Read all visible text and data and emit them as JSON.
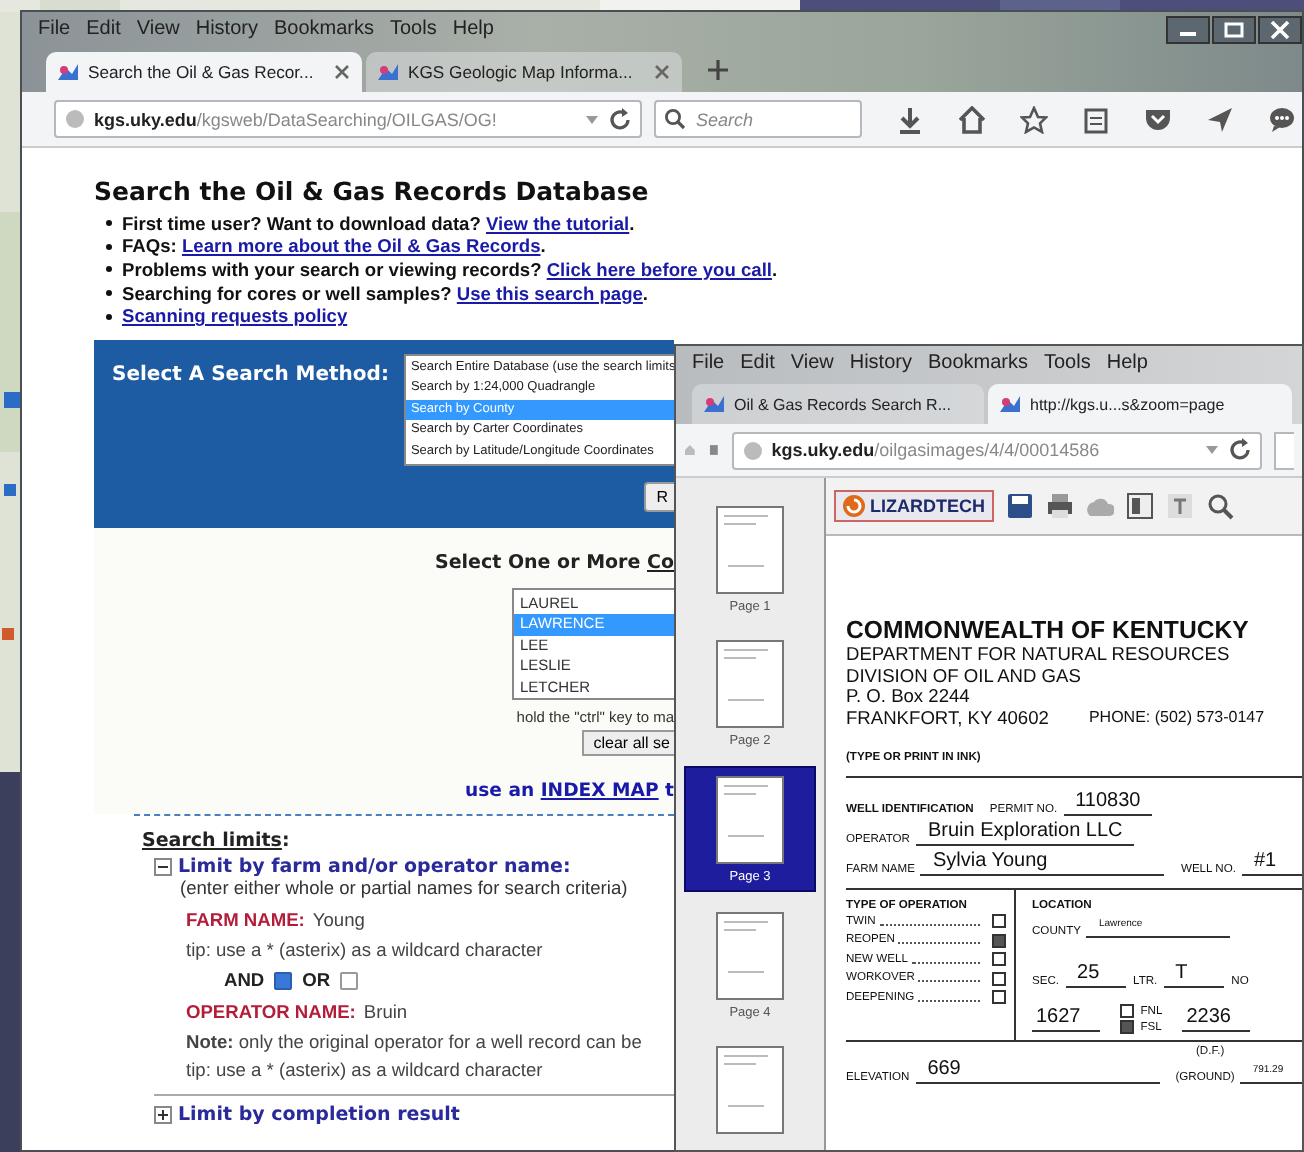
{
  "main_window": {
    "menu": [
      "File",
      "Edit",
      "View",
      "History",
      "Bookmarks",
      "Tools",
      "Help"
    ],
    "tabs": [
      {
        "label": "Search the Oil & Gas Recor...",
        "selected": true
      },
      {
        "label": "KGS Geologic Map Informa...",
        "selected": false
      }
    ],
    "url": {
      "host": "kgs.uky.edu",
      "path": "/kgsweb/DataSearching/OILGAS/OG!"
    },
    "search_placeholder": "Search",
    "page": {
      "heading": "Search the Oil & Gas Records Database",
      "bullets": [
        {
          "text": "First time user? Want to download data?",
          "link": "View the tutorial",
          "after": "."
        },
        {
          "text": "FAQs:",
          "link": "Learn more about the Oil & Gas Records",
          "after": "."
        },
        {
          "text": "Problems with your search or viewing records?",
          "link": "Click here before you call",
          "after": "."
        },
        {
          "text": "Searching for cores or well samples?",
          "link": "Use this search page",
          "after": "."
        },
        {
          "link": "Scanning requests policy"
        }
      ],
      "search_method": {
        "label": "Select A Search Method:",
        "button": "R",
        "options": [
          {
            "label": "Search Entire Database (use the search limits",
            "selected": false
          },
          {
            "label": "Search by 1:24,000 Quadrangle",
            "selected": false
          },
          {
            "label": "Search by County",
            "selected": true
          },
          {
            "label": "Search by Carter Coordinates",
            "selected": false
          },
          {
            "label": "Search by Latitude/Longitude Coordinates",
            "selected": false
          }
        ]
      },
      "county": {
        "heading": "Select One or More",
        "heading_link": "Co",
        "options": [
          {
            "label": "LAUREL",
            "selected": false
          },
          {
            "label": "LAWRENCE",
            "selected": true
          },
          {
            "label": "LEE",
            "selected": false
          },
          {
            "label": "LESLIE",
            "selected": false
          },
          {
            "label": "LETCHER",
            "selected": false
          }
        ],
        "hint": "hold the \"ctrl\" key to ma",
        "clear_button": "clear all se"
      },
      "index_map": {
        "before": "use an",
        "link": "INDEX MAP",
        "after": "t"
      },
      "limits": {
        "title": "Search limits",
        "title_after": ":",
        "farm_section": {
          "title": "Limit by farm and/or operator name:",
          "expanded": true,
          "hint": "(enter either whole or partial names for search criteria)",
          "farm_label": "FARM NAME:",
          "farm_value": "Young",
          "tip": "tip: use a  *  (asterix) as a wildcard character",
          "logic": [
            {
              "label": "AND",
              "selected": true
            },
            {
              "label": "OR",
              "selected": false
            }
          ],
          "operator_label": "OPERATOR NAME:",
          "operator_value": "Bruin",
          "note": "**Note:** only the original operator for a well record can be",
          "tip2": "tip: use a  *  (asterix) as a wildcard character"
        },
        "completion_section": {
          "title": "Limit by completion result",
          "expanded": false
        }
      }
    }
  },
  "viewer_window": {
    "menu": [
      "File",
      "Edit",
      "View",
      "History",
      "Bookmarks",
      "Tools",
      "Help"
    ],
    "tabs": [
      {
        "label": "Oil & Gas Records Search R...",
        "selected": false
      },
      {
        "label": "http://kgs.u...s&zoom=page",
        "selected": true
      }
    ],
    "url": {
      "host": "kgs.uky.edu",
      "path": "/oilgasimages/4/4/00014586"
    },
    "logo": "LIZARDTECH",
    "pages": [
      {
        "label": "Page 1",
        "selected": false
      },
      {
        "label": "Page 2",
        "selected": false
      },
      {
        "label": "Page 3",
        "selected": true
      },
      {
        "label": "Page 4",
        "selected": false
      },
      {
        "selected": false
      }
    ],
    "document": {
      "title": "COMMONWEALTH OF KENTUCKY",
      "lines": [
        "DEPARTMENT FOR NATURAL RESOURCES",
        "DIVISION OF OIL AND GAS",
        "P. O. Box 2244"
      ],
      "city": "FRANKFORT, KY  40602",
      "phone": "PHONE: (502) 573-0147",
      "instruction": "(TYPE OR PRINT IN INK)",
      "well_id": "WELL IDENTIFICATION",
      "permit_label": "PERMIT NO.",
      "permit": "110830",
      "operator_label": "OPERATOR",
      "operator": "Bruin Exploration LLC",
      "farm_label": "FARM NAME",
      "farm": "Sylvia Young",
      "well_label": "WELL NO.",
      "well": "#1",
      "operation_title": "TYPE OF OPERATION",
      "operations": [
        {
          "label": "TWIN",
          "checked": false
        },
        {
          "label": "REOPEN",
          "checked": true
        },
        {
          "label": "NEW WELL",
          "checked": false
        },
        {
          "label": "WORKOVER",
          "checked": false
        },
        {
          "label": "DEEPENING",
          "checked": false
        }
      ],
      "location_title": "LOCATION",
      "county_label": "COUNTY",
      "county": "Lawrence",
      "sec_label": "SEC.",
      "sec": "25",
      "ltr_label": "LTR.",
      "ltr": "T",
      "no_label": "NO",
      "ns_distance": "1627",
      "ns_refs": [
        {
          "label": "FNL",
          "checked": false
        },
        {
          "label": "FSL",
          "checked": true
        }
      ],
      "ew_distance": "2236",
      "elev_note": "(D.F.)",
      "elevation_label": "ELEVATION",
      "elevation": "669",
      "ground_label": "(GROUND)",
      "ground": "791.29"
    }
  }
}
